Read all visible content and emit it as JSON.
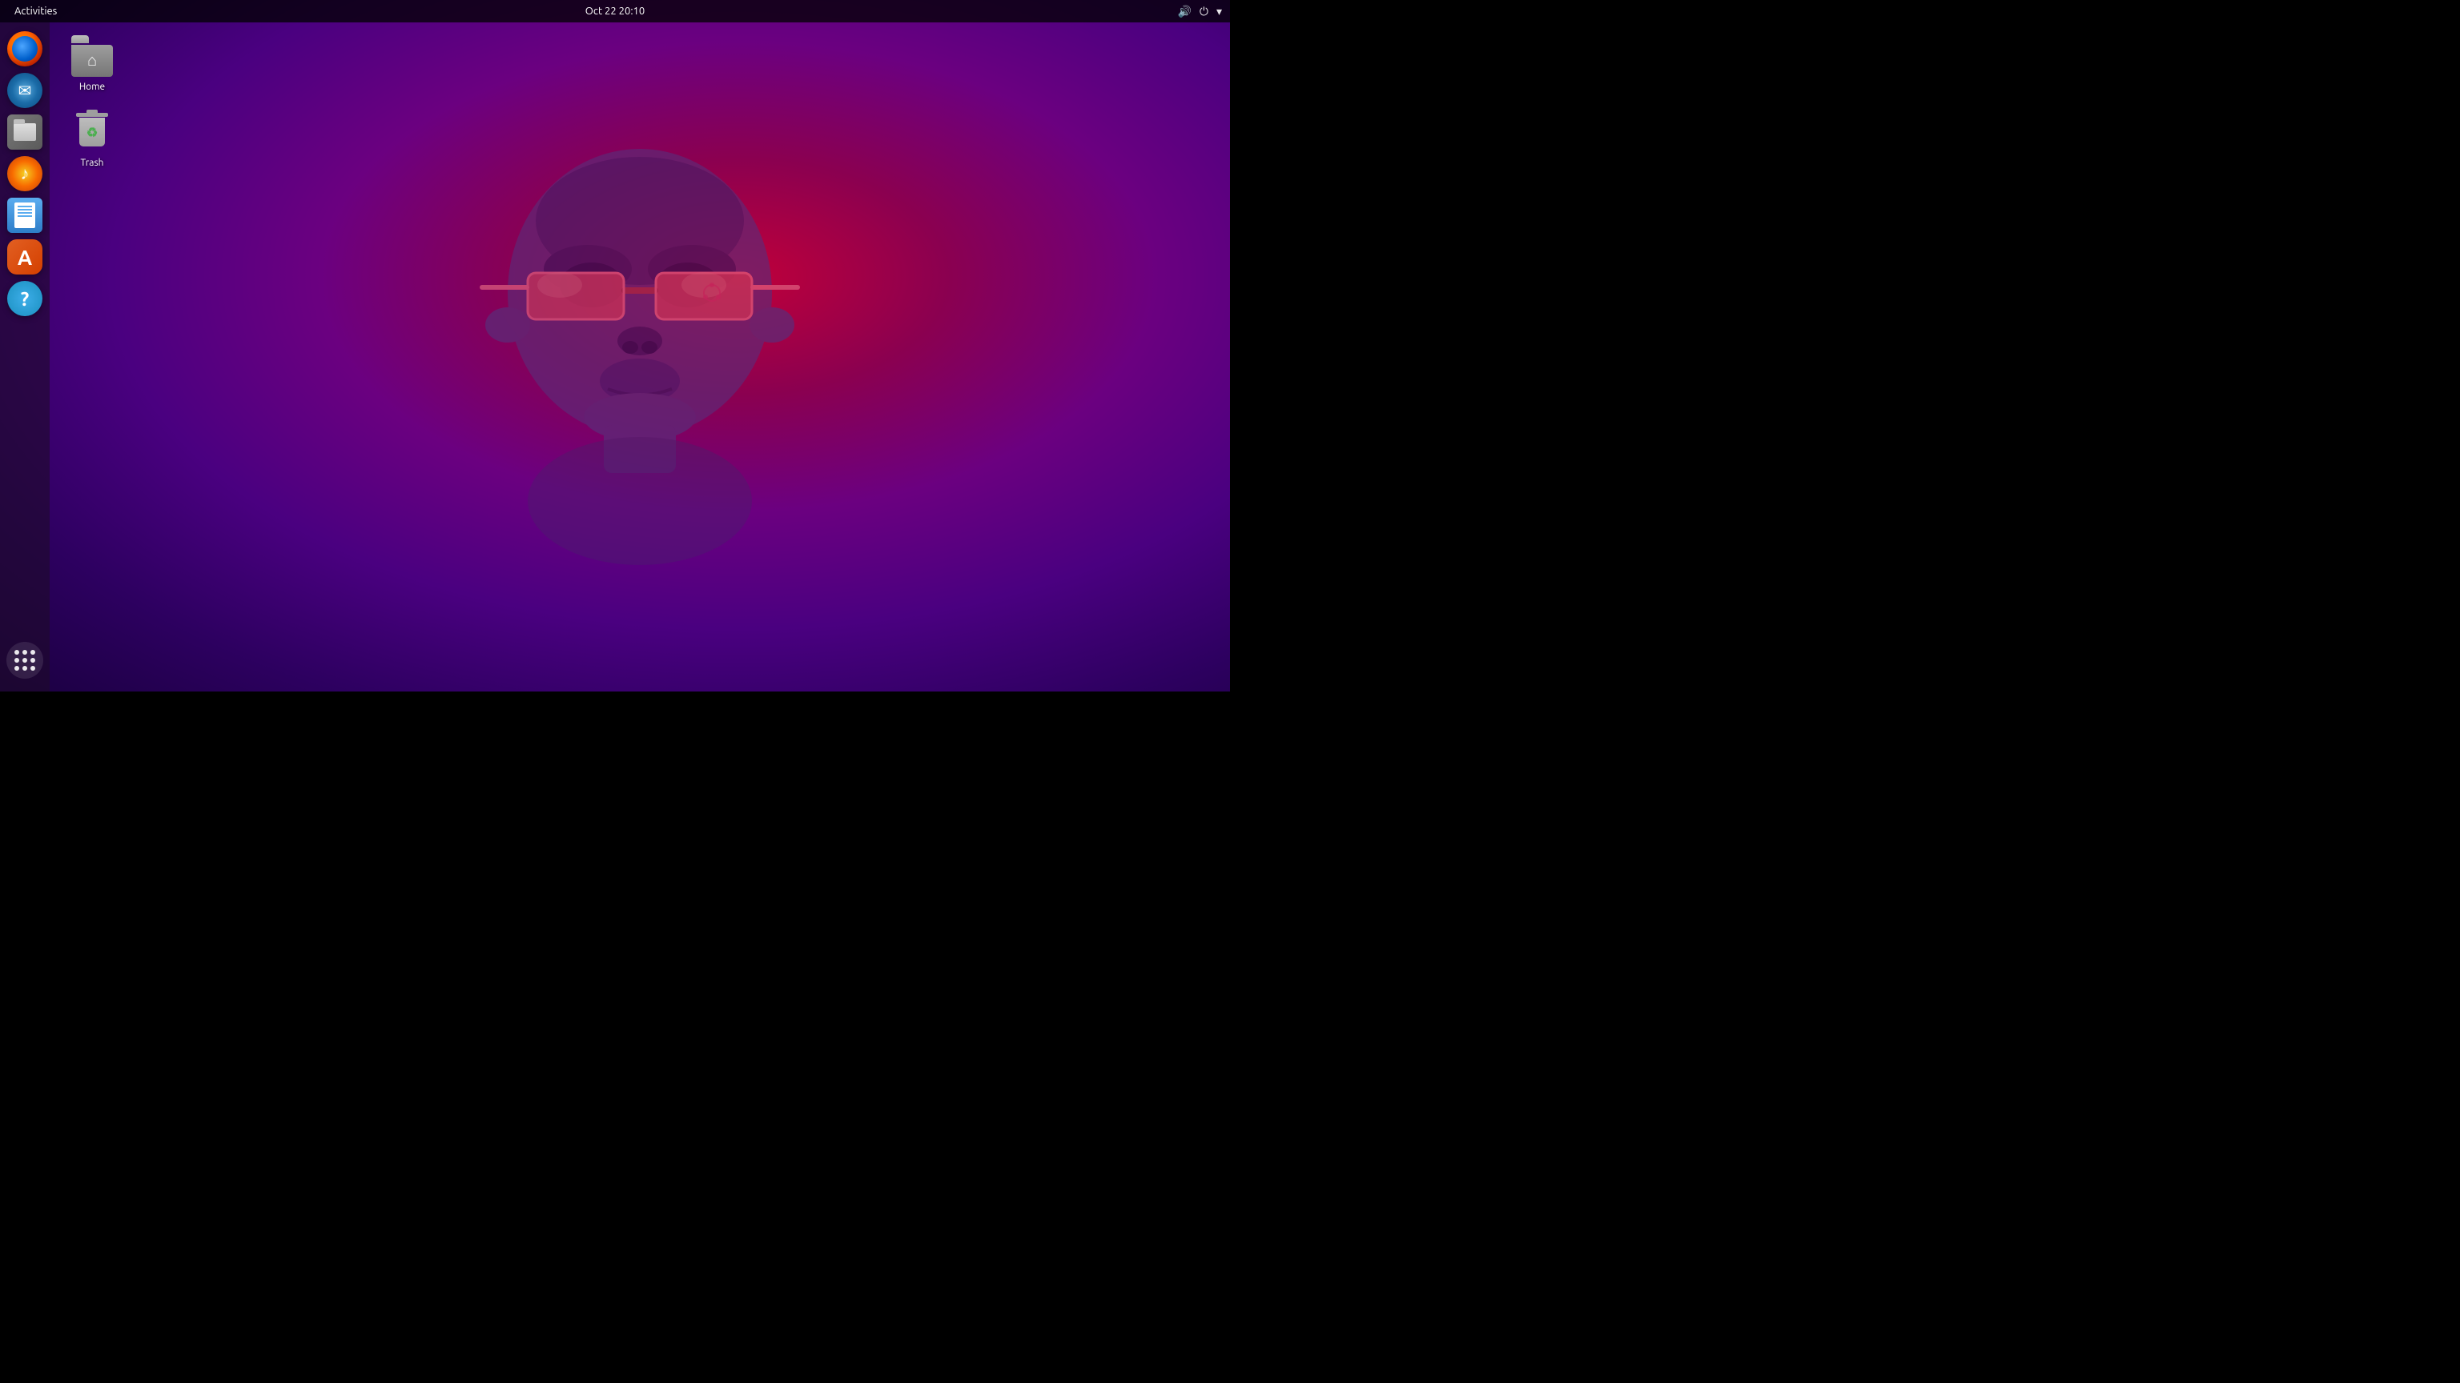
{
  "topbar": {
    "activities_label": "Activities",
    "clock": "Oct 22  20:10",
    "volume_icon": "🔊",
    "power_icon": "⏻",
    "menu_icon": "▾"
  },
  "desktop_icons": [
    {
      "id": "home",
      "label": "Home"
    },
    {
      "id": "trash",
      "label": "Trash"
    }
  ],
  "dock": {
    "apps": [
      {
        "id": "firefox",
        "label": "Firefox"
      },
      {
        "id": "thunderbird",
        "label": "Thunderbird"
      },
      {
        "id": "files",
        "label": "Files"
      },
      {
        "id": "rhythmbox",
        "label": "Rhythmbox"
      },
      {
        "id": "writer",
        "label": "LibreOffice Writer"
      },
      {
        "id": "appstore",
        "label": "App Center"
      },
      {
        "id": "help",
        "label": "Help"
      }
    ],
    "app_grid_label": "Show Applications"
  },
  "wallpaper": {
    "description": "Ubuntu Impish Indri gorilla with sunglasses on purple-red gradient"
  }
}
